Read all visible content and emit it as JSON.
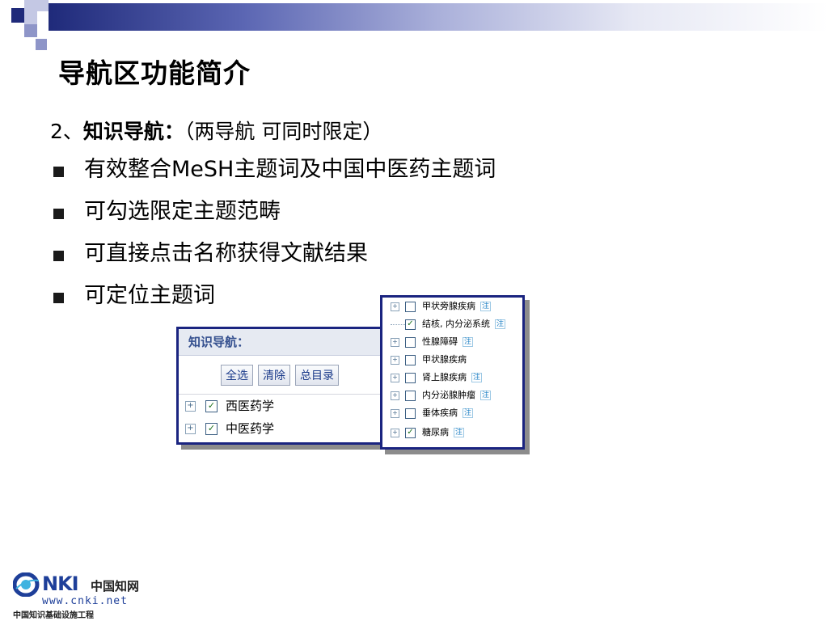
{
  "slide": {
    "title": "导航区功能简介",
    "subhead": {
      "prefix": "2、",
      "bold": "知识导航：",
      "note": "（两导航 可同时限定）"
    },
    "bullets": [
      "有效整合MeSH主题词及中国中医药主题词",
      "可勾选限定主题范畴",
      "可直接点击名称获得文献结果",
      "可定位主题词"
    ]
  },
  "nav_panel": {
    "header": "知识导航：",
    "buttons": [
      "全选",
      "清除",
      "总目录"
    ],
    "items": [
      {
        "label": "西医药学",
        "checked": true
      },
      {
        "label": "中医药学",
        "checked": true
      }
    ]
  },
  "list_panel": {
    "items": [
      {
        "label": "甲状旁腺疾病",
        "checked": false,
        "note": "注",
        "expand": true
      },
      {
        "label": "结核, 内分泌系统",
        "checked": true,
        "note": "注",
        "expand": false
      },
      {
        "label": "性腺障碍",
        "checked": false,
        "note": "注",
        "expand": true
      },
      {
        "label": "甲状腺疾病",
        "checked": false,
        "note": "",
        "expand": true
      },
      {
        "label": "肾上腺疾病",
        "checked": false,
        "note": "注",
        "expand": true
      },
      {
        "label": "内分泌腺肿瘤",
        "checked": false,
        "note": "注",
        "expand": true
      },
      {
        "label": "垂体疾病",
        "checked": false,
        "note": "注",
        "expand": true
      },
      {
        "label": "糖尿病",
        "checked": true,
        "note": "注",
        "expand": true
      }
    ]
  },
  "logo": {
    "brand": "NKI",
    "cn_name": "中国知网",
    "url": "www.cnki.net",
    "subtitle": "中国知识基础设施工程"
  }
}
